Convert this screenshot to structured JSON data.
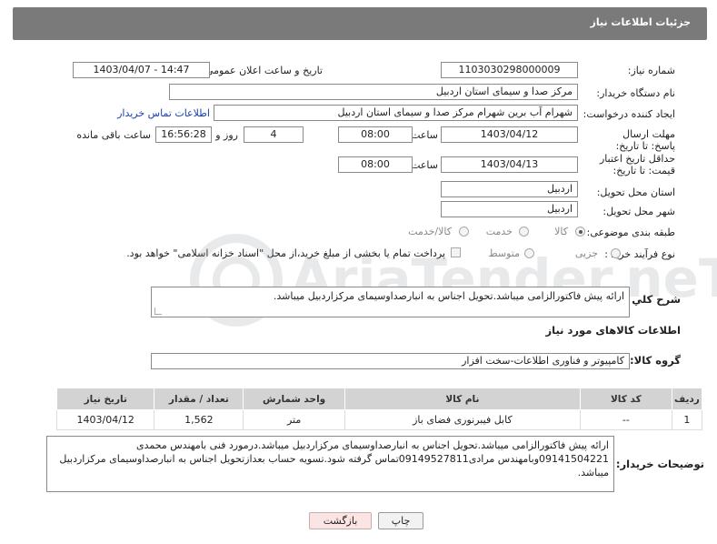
{
  "header": {
    "title": "جزئیات اطلاعات نیاز"
  },
  "form": {
    "need_number_label": "شماره نیاز:",
    "need_number": "1103030298000009",
    "announce_label": "تاریخ و ساعت اعلان عمومی:",
    "announce_value": "1403/04/07 - 14:47",
    "buyer_org_label": "نام دستگاه خریدار:",
    "buyer_org": "مرکز صدا و سیمای استان اردبیل",
    "requester_label": "ایجاد کننده درخواست:",
    "requester": "شهرام آب برین شهرام مرکز صدا و سیمای استان اردبیل",
    "contact_link": "اطلاعات تماس خریدار",
    "reply_deadline_label": "مهلت ارسال پاسخ: تا تاریخ:",
    "reply_date": "1403/04/12",
    "time_label": "ساعت",
    "reply_time": "08:00",
    "days_value": "4",
    "days_label": "روز و",
    "remaining_time": "16:56:28",
    "remaining_label": "ساعت باقی مانده",
    "price_validity_label": "حداقل تاریخ اعتبار قیمت: تا تاریخ:",
    "validity_date": "1403/04/13",
    "validity_time": "08:00",
    "province_label": "استان محل تحویل:",
    "province": "اردبیل",
    "city_label": "شهر محل تحویل:",
    "city": "اردبیل",
    "category_label": "طبقه بندی موضوعی:",
    "category_options": [
      "کالا",
      "خدمت",
      "کالا/خدمت"
    ],
    "process_label": "نوع فرآیند خرید :",
    "process_options": [
      "جزیی",
      "متوسط"
    ],
    "payment_note": "پرداخت تمام یا بخشی از مبلغ خرید،از محل \"اسناد خزانه اسلامی\" خواهد بود."
  },
  "description": {
    "label": "شرح کلي نياز:",
    "text": "ارائه پیش فاکتورالزامی میباشد.تحویل اجناس به انبارصداوسیمای مرکزاردبیل میباشد."
  },
  "goods": {
    "section_title": "اطلاعات کالاهای مورد نیاز",
    "group_label": "گروه کالا:",
    "group_value": "کامپیوتر و فناوری اطلاعات-سخت افزار",
    "columns": [
      "ردیف",
      "کد کالا",
      "نام کالا",
      "واحد شمارش",
      "تعداد / مقدار",
      "تاریخ نیاز"
    ],
    "rows": [
      {
        "row": "1",
        "code": "--",
        "name": "کابل فیبرنوری فضای باز",
        "unit": "متر",
        "qty": "1,562",
        "date": "1403/04/12"
      }
    ]
  },
  "buyer_notes": {
    "label": "توضیحات خریدار:",
    "text": "ارائه پیش فاکتورالزامی میباشد.تحویل اجناس به انبارصداوسیمای مرکزاردبیل میباشد.درمورد فنی بامهندس محمدی 09141504221وبامهندس مرادی09149527811تماس گرفته شود.تسویه حساب بعدازتحویل اجناس به انبارصداوسیمای مرکزاردبیل میباشد."
  },
  "buttons": {
    "print": "چاپ",
    "back": "بازگشت"
  },
  "watermark": {
    "text": "AriaTender.neT"
  },
  "colors": {
    "header_bg": "#7a7a7a",
    "link": "#1a3fae",
    "back_btn": "#fbe4e4"
  }
}
